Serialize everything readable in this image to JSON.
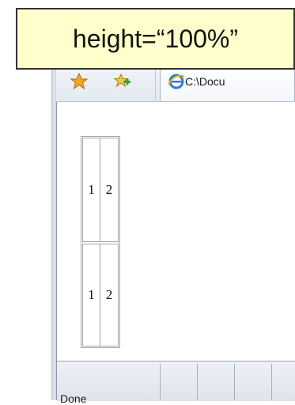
{
  "caption": {
    "text": "height=“100%”"
  },
  "browser": {
    "toolbar_icons": [
      "favorites-star-icon",
      "add-favorites-icon"
    ],
    "tab": {
      "icon": "ie-icon",
      "title": "C:\\Docu"
    },
    "status": {
      "text": "Done"
    }
  },
  "table": {
    "rows": [
      [
        "1",
        "2"
      ],
      [
        "1",
        "2"
      ]
    ]
  },
  "colors": {
    "caption_bg": "#ffffcc",
    "star": "#f5a623",
    "add_fav": "#3fa13f",
    "ie_blue": "#2a7de1"
  }
}
